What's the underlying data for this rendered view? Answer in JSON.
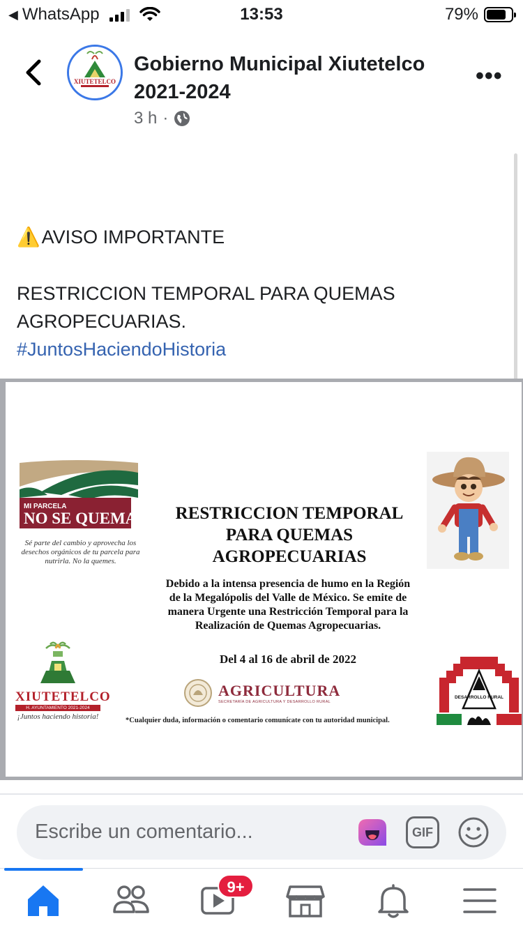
{
  "status_bar": {
    "back_app": "WhatsApp",
    "time": "13:53",
    "battery_percent": "79%",
    "battery_level": 0.79
  },
  "header": {
    "page_name": "Gobierno Municipal Xiutetelco 2021-2024",
    "time_ago": "3 h",
    "separator": "·",
    "privacy_icon": "globe-icon",
    "more_label": "•••"
  },
  "post": {
    "notice": "AVISO IMPORTANTE",
    "notice_icon": "⚠️",
    "body": "RESTRICCION TEMPORAL PARA QUEMAS AGROPECUARIAS.",
    "hashtag": "#JuntosHaciendoHistoria"
  },
  "flyer": {
    "campaign_top": "MI PARCELA",
    "campaign_main": "NO SE QUEMA",
    "campaign_sub": "Sé parte del cambio y aprovecha los desechos orgánicos de tu parcela para nutrirla. No la quemes.",
    "title": "RESTRICCION TEMPORAL PARA QUEMAS AGROPECUARIAS",
    "body": "Debido a la intensa presencia de humo en la Región de la Megalópolis del Valle de México. Se emite de manera Urgente una Restricción Temporal para la Realización de Quemas Agropecuarias.",
    "dates": "Del 4 al 16 de abril de 2022",
    "agri_title": "AGRICULTURA",
    "agri_sub": "SECRETARÍA DE AGRICULTURA Y DESARROLLO RURAL",
    "note": "*Cualquier duda, información o comentario comunícate con tu autoridad municipal.",
    "xiu_name": "XIUTETELCO",
    "xiu_band": "H. AYUNTAMIENTO 2021-2024",
    "xiu_slogan": "¡Juntos haciendo historia!",
    "desarrollo_label": "DESARROLLO RURAL"
  },
  "comment": {
    "placeholder": "Escribe un comentario...",
    "gif_label": "GIF"
  },
  "tabs": {
    "notifications_badge": "9+",
    "items": [
      "home-icon",
      "friends-icon",
      "watch-icon",
      "marketplace-icon",
      "notifications-icon",
      "menu-icon"
    ],
    "active_color": "#1877f2"
  }
}
